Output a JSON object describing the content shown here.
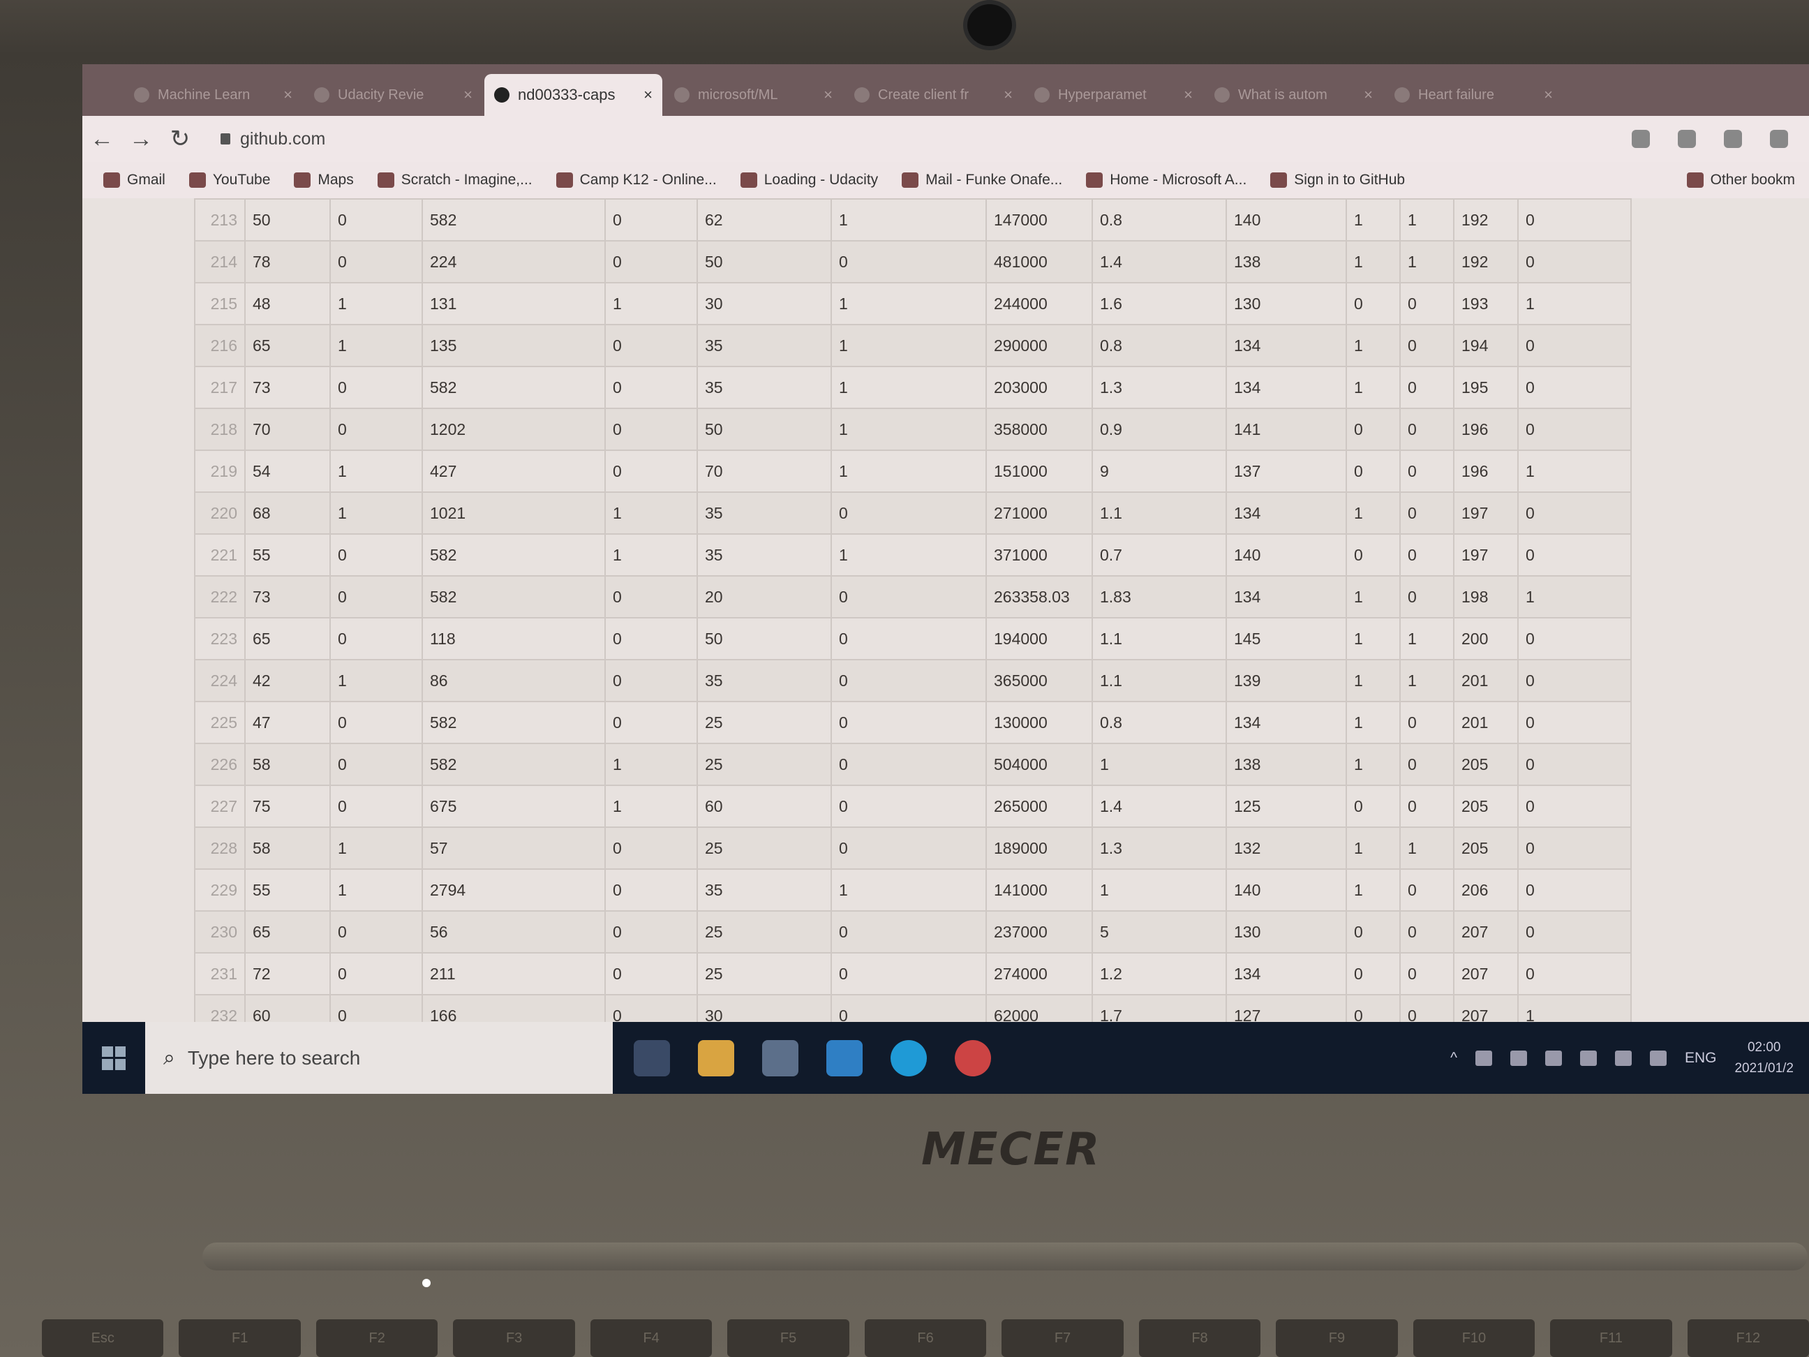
{
  "browser": {
    "tabs": [
      {
        "label": "Machine Learn"
      },
      {
        "label": "Udacity Revie"
      },
      {
        "label": "nd00333-caps"
      },
      {
        "label": "microsoft/ML"
      },
      {
        "label": "Create client fr"
      },
      {
        "label": "Hyperparamet"
      },
      {
        "label": "What is autom"
      },
      {
        "label": "Heart failure"
      }
    ],
    "active_tab_index": 2,
    "url": "github.com",
    "bookmarks": [
      {
        "label": "Gmail"
      },
      {
        "label": "YouTube"
      },
      {
        "label": "Maps"
      },
      {
        "label": "Scratch - Imagine,..."
      },
      {
        "label": "Camp K12 - Online..."
      },
      {
        "label": "Loading - Udacity"
      },
      {
        "label": "Mail - Funke Onafe..."
      },
      {
        "label": "Home - Microsoft A..."
      },
      {
        "label": "Sign in to GitHub"
      },
      {
        "label": "Other bookm"
      }
    ]
  },
  "table": {
    "rows": [
      [
        "213",
        "50",
        "0",
        "582",
        "0",
        "62",
        "1",
        "147000",
        "0.8",
        "140",
        "1",
        "1",
        "192",
        "0"
      ],
      [
        "214",
        "78",
        "0",
        "224",
        "0",
        "50",
        "0",
        "481000",
        "1.4",
        "138",
        "1",
        "1",
        "192",
        "0"
      ],
      [
        "215",
        "48",
        "1",
        "131",
        "1",
        "30",
        "1",
        "244000",
        "1.6",
        "130",
        "0",
        "0",
        "193",
        "1"
      ],
      [
        "216",
        "65",
        "1",
        "135",
        "0",
        "35",
        "1",
        "290000",
        "0.8",
        "134",
        "1",
        "0",
        "194",
        "0"
      ],
      [
        "217",
        "73",
        "0",
        "582",
        "0",
        "35",
        "1",
        "203000",
        "1.3",
        "134",
        "1",
        "0",
        "195",
        "0"
      ],
      [
        "218",
        "70",
        "0",
        "1202",
        "0",
        "50",
        "1",
        "358000",
        "0.9",
        "141",
        "0",
        "0",
        "196",
        "0"
      ],
      [
        "219",
        "54",
        "1",
        "427",
        "0",
        "70",
        "1",
        "151000",
        "9",
        "137",
        "0",
        "0",
        "196",
        "1"
      ],
      [
        "220",
        "68",
        "1",
        "1021",
        "1",
        "35",
        "0",
        "271000",
        "1.1",
        "134",
        "1",
        "0",
        "197",
        "0"
      ],
      [
        "221",
        "55",
        "0",
        "582",
        "1",
        "35",
        "1",
        "371000",
        "0.7",
        "140",
        "0",
        "0",
        "197",
        "0"
      ],
      [
        "222",
        "73",
        "0",
        "582",
        "0",
        "20",
        "0",
        "263358.03",
        "1.83",
        "134",
        "1",
        "0",
        "198",
        "1"
      ],
      [
        "223",
        "65",
        "0",
        "118",
        "0",
        "50",
        "0",
        "194000",
        "1.1",
        "145",
        "1",
        "1",
        "200",
        "0"
      ],
      [
        "224",
        "42",
        "1",
        "86",
        "0",
        "35",
        "0",
        "365000",
        "1.1",
        "139",
        "1",
        "1",
        "201",
        "0"
      ],
      [
        "225",
        "47",
        "0",
        "582",
        "0",
        "25",
        "0",
        "130000",
        "0.8",
        "134",
        "1",
        "0",
        "201",
        "0"
      ],
      [
        "226",
        "58",
        "0",
        "582",
        "1",
        "25",
        "0",
        "504000",
        "1",
        "138",
        "1",
        "0",
        "205",
        "0"
      ],
      [
        "227",
        "75",
        "0",
        "675",
        "1",
        "60",
        "0",
        "265000",
        "1.4",
        "125",
        "0",
        "0",
        "205",
        "0"
      ],
      [
        "228",
        "58",
        "1",
        "57",
        "0",
        "25",
        "0",
        "189000",
        "1.3",
        "132",
        "1",
        "1",
        "205",
        "0"
      ],
      [
        "229",
        "55",
        "1",
        "2794",
        "0",
        "35",
        "1",
        "141000",
        "1",
        "140",
        "1",
        "0",
        "206",
        "0"
      ],
      [
        "230",
        "65",
        "0",
        "56",
        "0",
        "25",
        "0",
        "237000",
        "5",
        "130",
        "0",
        "0",
        "207",
        "0"
      ],
      [
        "231",
        "72",
        "0",
        "211",
        "0",
        "25",
        "0",
        "274000",
        "1.2",
        "134",
        "0",
        "0",
        "207",
        "0"
      ],
      [
        "232",
        "60",
        "0",
        "166",
        "0",
        "30",
        "0",
        "62000",
        "1.7",
        "127",
        "0",
        "0",
        "207",
        "1"
      ]
    ]
  },
  "taskbar": {
    "search_placeholder": "Type here to search",
    "language": "ENG",
    "time": "02:00",
    "date": "2021/01/2"
  },
  "laptop": {
    "brand": "MECER",
    "keys": [
      "Esc",
      "F1",
      "F2",
      "F3",
      "F4",
      "F5",
      "F6",
      "F7",
      "F8",
      "F9",
      "F10",
      "F11",
      "F12"
    ]
  }
}
